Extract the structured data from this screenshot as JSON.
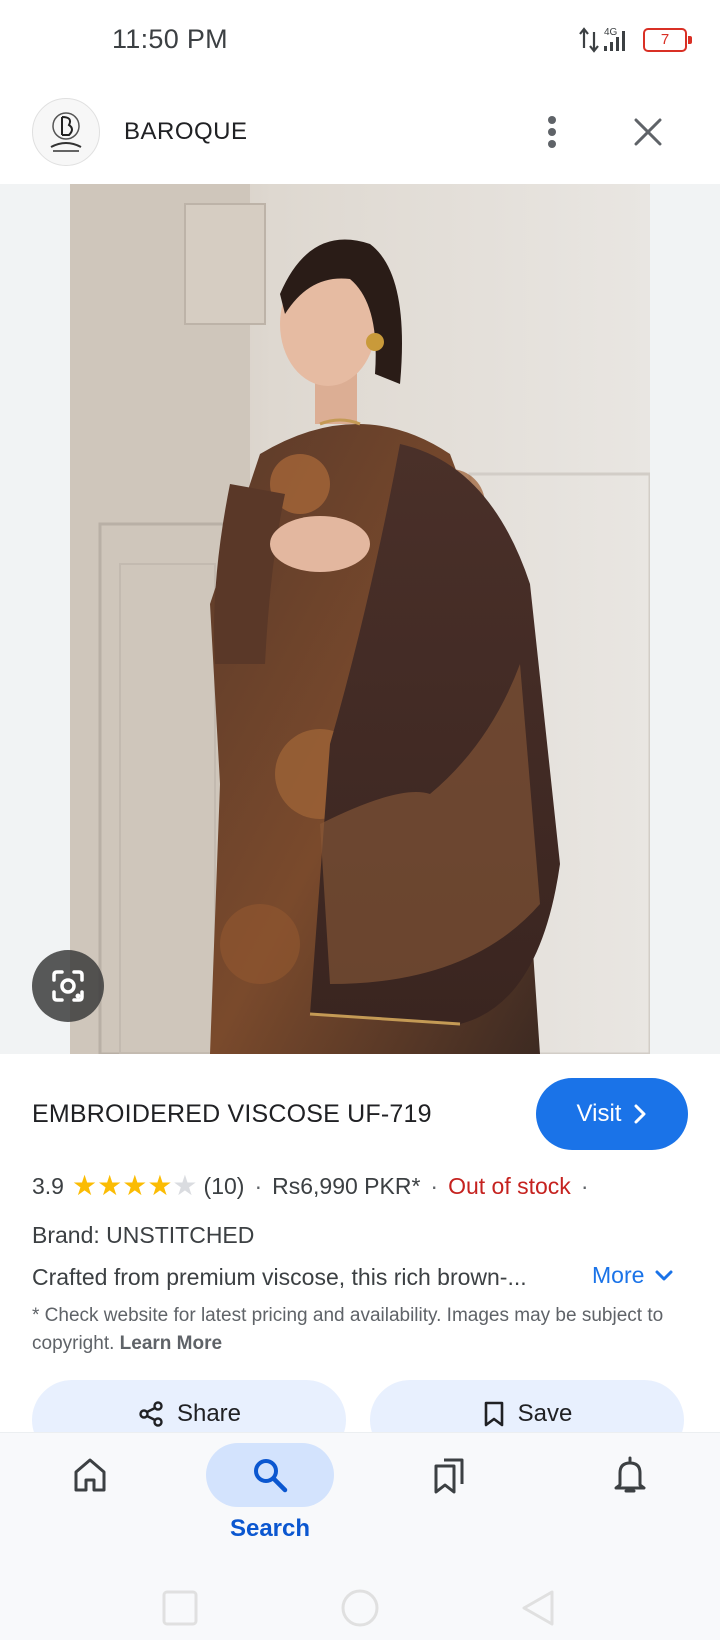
{
  "status_bar": {
    "time": "11:50 PM",
    "network": "4G",
    "battery": "7"
  },
  "header": {
    "brand": "BAROQUE",
    "icons": [
      "more-vert-icon",
      "close-icon"
    ]
  },
  "image": {
    "alt_subject": "product-photo",
    "icons": [
      "lens-icon"
    ]
  },
  "product": {
    "title": "EMBROIDERED VISCOSE UF-719",
    "visit_label": "Visit",
    "rating": "3.9",
    "rating_value": 3.9,
    "rating_max": 5,
    "review_count": "(10)",
    "price": "Rs6,990 PKR*",
    "stock": "Out of stock",
    "brand_line": "Brand: UNSTITCHED",
    "description": "Crafted from premium viscose, this rich brown-...",
    "more_label": "More",
    "disclaimer": "* Check website for latest pricing and availability. Images may be subject to copyright.",
    "learn_more": "Learn More"
  },
  "actions": {
    "share_label": "Share",
    "save_label": "Save"
  },
  "bottom_nav": {
    "items": [
      {
        "icon": "home-icon",
        "label": ""
      },
      {
        "icon": "search-icon",
        "label": "Search",
        "active": true
      },
      {
        "icon": "collections-icon",
        "label": ""
      },
      {
        "icon": "bell-icon",
        "label": ""
      }
    ]
  },
  "colors": {
    "accent": "#1a73e8",
    "out_of_stock": "#c5221f",
    "star": "#fbbc04"
  }
}
